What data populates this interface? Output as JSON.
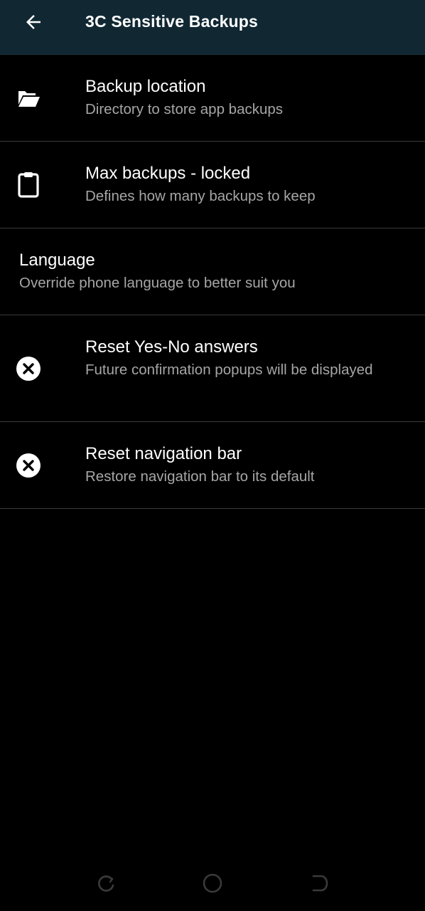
{
  "app_bar": {
    "title": "3C Sensitive Backups",
    "back_icon": "arrow-left-icon",
    "background": "#112833"
  },
  "settings": [
    {
      "title": "Backup location",
      "summary": "Directory to store app backups",
      "icon": "folder-open-icon"
    },
    {
      "title": "Max backups - locked",
      "summary": "Defines how many backups to keep",
      "icon": "clipboard-icon"
    },
    {
      "title": "Language",
      "summary": "Override phone language to better suit you",
      "icon": ""
    },
    {
      "title": "Reset Yes-No answers",
      "summary": "Future confirmation popups will be displayed",
      "icon": "close-circle-icon"
    },
    {
      "title": "Reset navigation bar",
      "summary": "Restore navigation bar to its default",
      "icon": "close-circle-icon"
    }
  ],
  "system_nav": {
    "buttons": [
      "recents-icon",
      "home-icon",
      "back-icon"
    ],
    "color": "#3a3a3a"
  }
}
